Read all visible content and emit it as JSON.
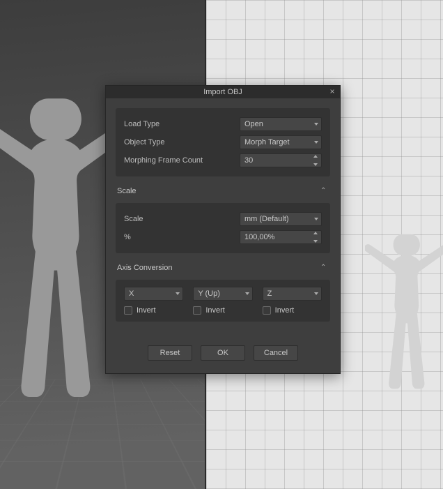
{
  "dialog": {
    "title": "Import OBJ",
    "load_type_label": "Load Type",
    "load_type_value": "Open",
    "object_type_label": "Object Type",
    "object_type_value": "Morph Target",
    "morph_count_label": "Morphing Frame Count",
    "morph_count_value": "30",
    "scale_header": "Scale",
    "scale_label": "Scale",
    "scale_value": "mm (Default)",
    "percent_label": "%",
    "percent_value": "100,00%",
    "axis_header": "Axis Conversion",
    "axis_x": "X",
    "axis_y": "Y (Up)",
    "axis_z": "Z",
    "invert_label": "Invert",
    "buttons": {
      "reset": "Reset",
      "ok": "OK",
      "cancel": "Cancel"
    }
  }
}
